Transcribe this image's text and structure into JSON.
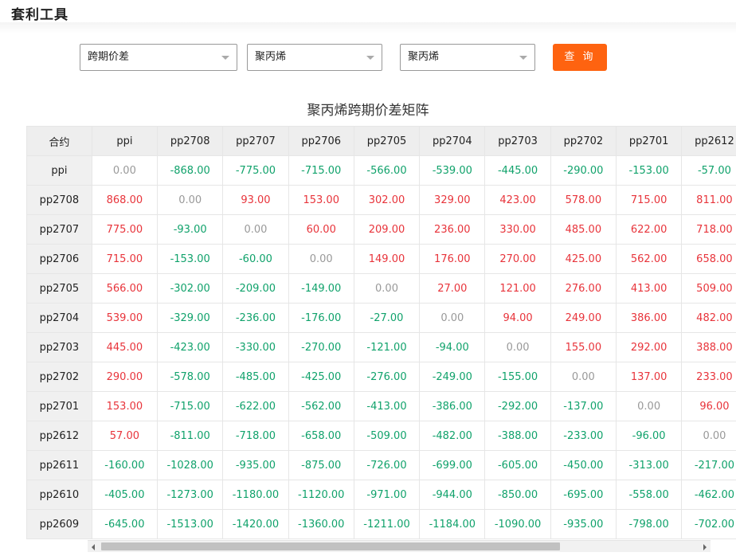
{
  "page": {
    "title": "套利工具"
  },
  "filters": {
    "type": "跨期价差",
    "product1": "聚丙烯",
    "product2": "聚丙烯",
    "query_label": "查 询"
  },
  "matrix": {
    "title": "聚丙烯跨期价差矩阵",
    "corner": "合约",
    "columns": [
      "ppi",
      "pp2708",
      "pp2707",
      "pp2706",
      "pp2705",
      "pp2704",
      "pp2703",
      "pp2702",
      "pp2701",
      "pp2612"
    ],
    "rows": [
      {
        "label": "ppi",
        "values": [
          "0.00",
          "-868.00",
          "-775.00",
          "-715.00",
          "-566.00",
          "-539.00",
          "-445.00",
          "-290.00",
          "-153.00",
          "-57.00"
        ]
      },
      {
        "label": "pp2708",
        "values": [
          "868.00",
          "0.00",
          "93.00",
          "153.00",
          "302.00",
          "329.00",
          "423.00",
          "578.00",
          "715.00",
          "811.00"
        ]
      },
      {
        "label": "pp2707",
        "values": [
          "775.00",
          "-93.00",
          "0.00",
          "60.00",
          "209.00",
          "236.00",
          "330.00",
          "485.00",
          "622.00",
          "718.00"
        ]
      },
      {
        "label": "pp2706",
        "values": [
          "715.00",
          "-153.00",
          "-60.00",
          "0.00",
          "149.00",
          "176.00",
          "270.00",
          "425.00",
          "562.00",
          "658.00"
        ]
      },
      {
        "label": "pp2705",
        "values": [
          "566.00",
          "-302.00",
          "-209.00",
          "-149.00",
          "0.00",
          "27.00",
          "121.00",
          "276.00",
          "413.00",
          "509.00"
        ]
      },
      {
        "label": "pp2704",
        "values": [
          "539.00",
          "-329.00",
          "-236.00",
          "-176.00",
          "-27.00",
          "0.00",
          "94.00",
          "249.00",
          "386.00",
          "482.00"
        ]
      },
      {
        "label": "pp2703",
        "values": [
          "445.00",
          "-423.00",
          "-330.00",
          "-270.00",
          "-121.00",
          "-94.00",
          "0.00",
          "155.00",
          "292.00",
          "388.00"
        ]
      },
      {
        "label": "pp2702",
        "values": [
          "290.00",
          "-578.00",
          "-485.00",
          "-425.00",
          "-276.00",
          "-249.00",
          "-155.00",
          "0.00",
          "137.00",
          "233.00"
        ]
      },
      {
        "label": "pp2701",
        "values": [
          "153.00",
          "-715.00",
          "-622.00",
          "-562.00",
          "-413.00",
          "-386.00",
          "-292.00",
          "-137.00",
          "0.00",
          "96.00"
        ]
      },
      {
        "label": "pp2612",
        "values": [
          "57.00",
          "-811.00",
          "-718.00",
          "-658.00",
          "-509.00",
          "-482.00",
          "-388.00",
          "-233.00",
          "-96.00",
          "0.00"
        ]
      },
      {
        "label": "pp2611",
        "values": [
          "-160.00",
          "-1028.00",
          "-935.00",
          "-875.00",
          "-726.00",
          "-699.00",
          "-605.00",
          "-450.00",
          "-313.00",
          "-217.00"
        ]
      },
      {
        "label": "pp2610",
        "values": [
          "-405.00",
          "-1273.00",
          "-1180.00",
          "-1120.00",
          "-971.00",
          "-944.00",
          "-850.00",
          "-695.00",
          "-558.00",
          "-462.00"
        ]
      },
      {
        "label": "pp2609",
        "values": [
          "-645.00",
          "-1513.00",
          "-1420.00",
          "-1360.00",
          "-1211.00",
          "-1184.00",
          "-1090.00",
          "-935.00",
          "-798.00",
          "-702.00"
        ]
      }
    ]
  },
  "colors": {
    "positive": "#e8343b",
    "negative": "#10a26b",
    "zero": "#999999",
    "accent": "#fe6310"
  }
}
